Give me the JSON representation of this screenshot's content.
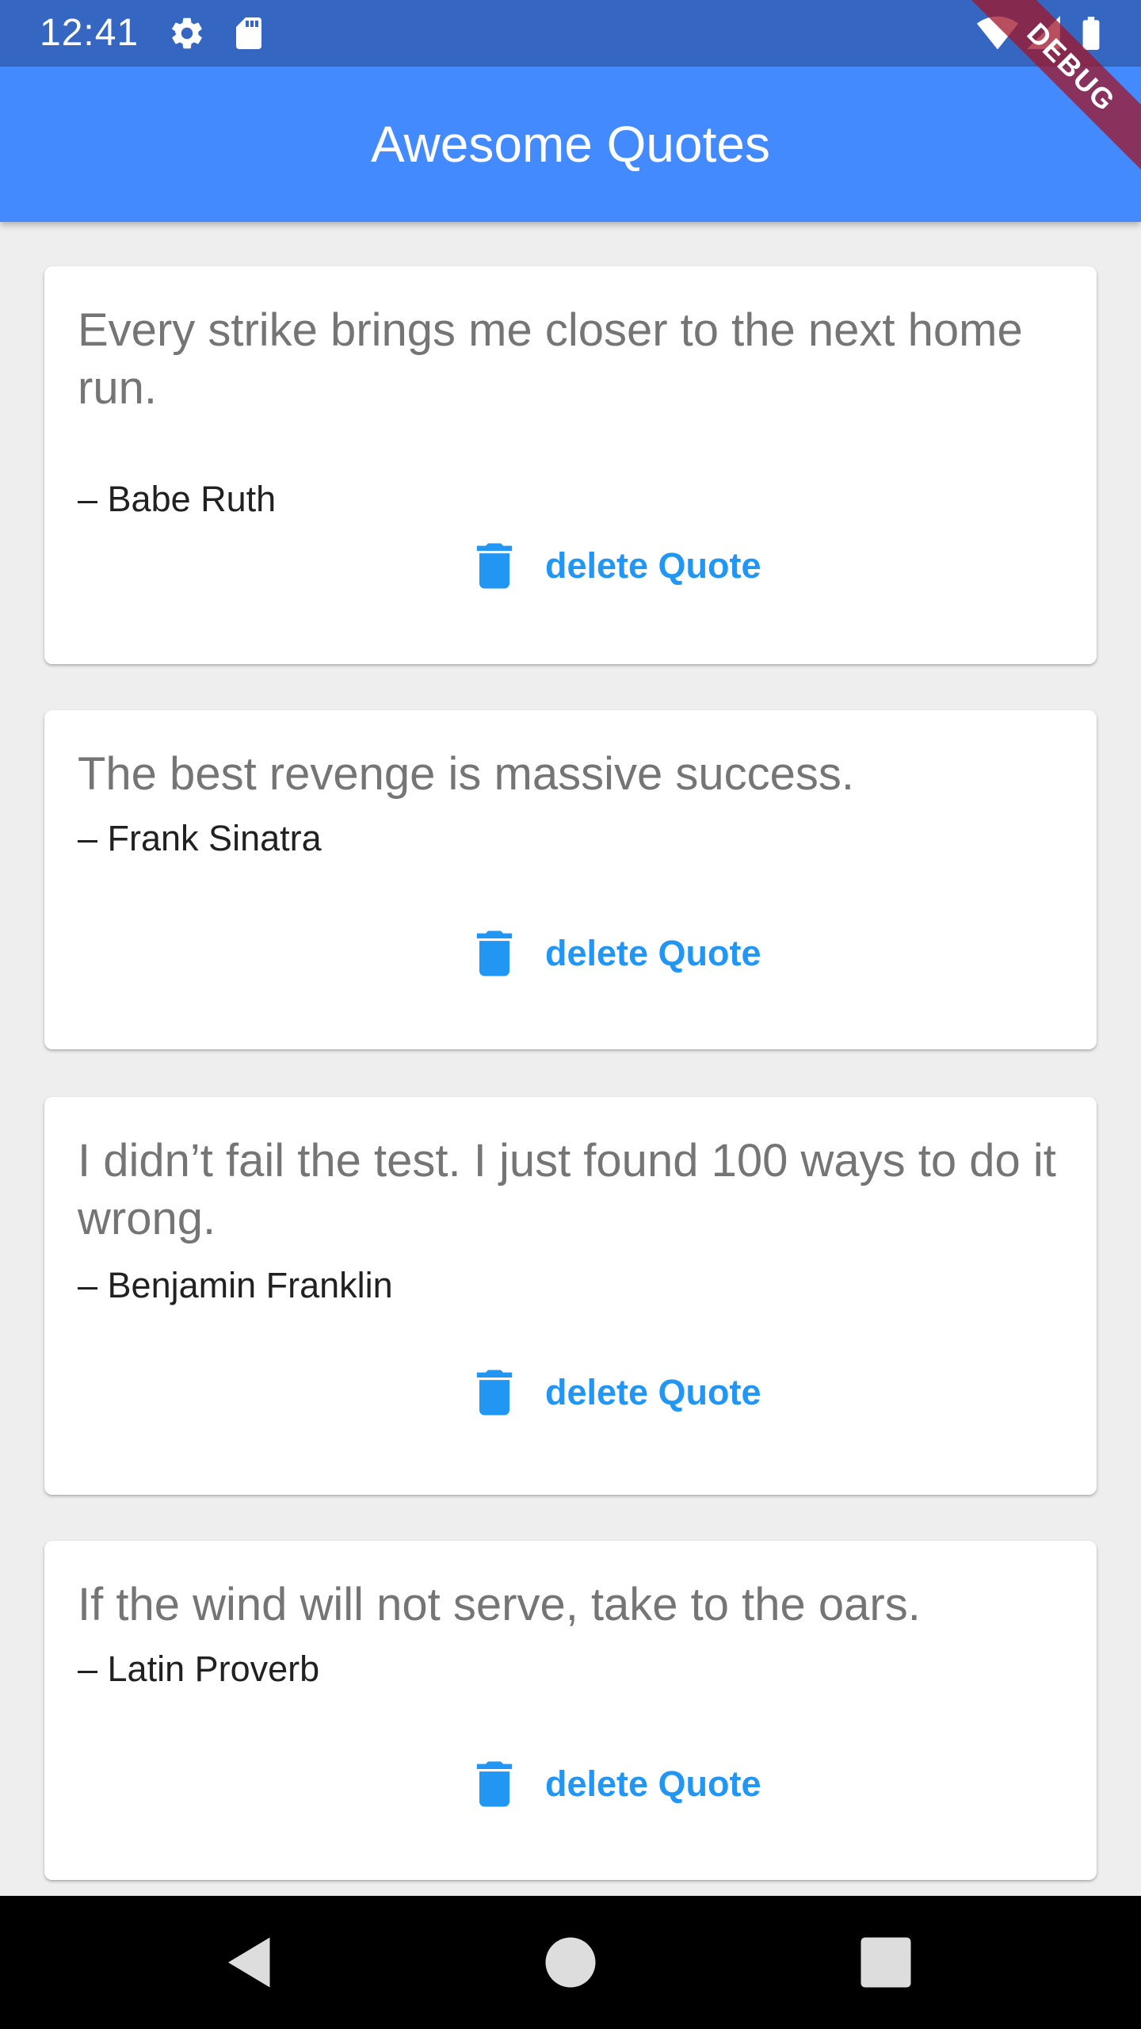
{
  "status_bar": {
    "time": "12:41",
    "icons_left": [
      "settings-icon",
      "sd-card-icon"
    ],
    "icons_right": [
      "wifi-icon",
      "cell-signal-icon",
      "battery-icon"
    ],
    "color": "#3567c2"
  },
  "app_bar": {
    "title": "Awesome Quotes",
    "color": "#448aff"
  },
  "debug_banner": {
    "label": "DEBUG"
  },
  "quotes": [
    {
      "text": "Every strike brings me closer to the next home run.",
      "author": "– Babe Ruth",
      "delete_label": "delete Quote"
    },
    {
      "text": "The best revenge is massive success.",
      "author": "– Frank Sinatra",
      "delete_label": "delete Quote"
    },
    {
      "text": "I didn’t fail the test. I just found 100 ways to do it wrong.",
      "author": "– Benjamin Franklin",
      "delete_label": "delete Quote"
    },
    {
      "text": "If the wind will not serve, take to the oars.",
      "author": "– Latin Proverb",
      "delete_label": "delete Quote"
    }
  ],
  "accent_color": "#2196f3",
  "nav_bar": {
    "buttons": [
      "back-icon",
      "home-icon",
      "recents-icon"
    ]
  }
}
